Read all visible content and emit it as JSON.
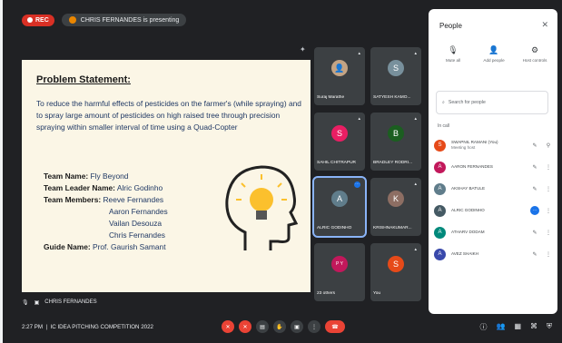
{
  "topbar": {
    "rec_label": "REC",
    "presenting_text": "CHRIS FERNANDES is presenting"
  },
  "slide": {
    "title": "Problem Statement:",
    "body": "To reduce the harmful effects of pesticides on the farmer's (while spraying) and to spray large amount of pesticides on high raised tree through precision spraying within  smaller interval of time using a Quad-Copter",
    "team_name_label": "Team Name:",
    "team_name": "Fly Beyond",
    "leader_label": "Team Leader Name:",
    "leader": "Alric Godinho",
    "members_label": "Team Members:",
    "members": [
      "Reeve Fernandes",
      "Aaron Fernandes",
      "Vailan Desouza",
      "Chris Fernandes"
    ],
    "guide_label": "Guide Name:",
    "guide": "Prof. Gaurish Samant"
  },
  "presenter_name": "CHRIS FERNANDES",
  "tiles": [
    {
      "name": "Suraj Marathe",
      "initial": "",
      "color": "#c4a484"
    },
    {
      "name": "SATYESH KAMO...",
      "initial": "S",
      "color": "#78909c"
    },
    {
      "name": "SAHIL CHITRAPUR",
      "initial": "S",
      "color": "#e91e63"
    },
    {
      "name": "BRADLEY RODRI...",
      "initial": "B",
      "color": "#1b5e20"
    },
    {
      "name": "ALRIC GODINHO",
      "initial": "A",
      "color": "#607d8b"
    },
    {
      "name": "KRISHNAKUMAR...",
      "initial": "K",
      "color": "#8d6e63"
    },
    {
      "name": "23 others",
      "initial": "P Y",
      "color": "#c2185b"
    },
    {
      "name": "You",
      "initial": "S",
      "color": "#e64a19"
    }
  ],
  "bottombar": {
    "time": "2:27 PM",
    "meeting": "IC IDEA PITCHING COMPETITION 2022"
  },
  "people_panel": {
    "title": "People",
    "mute_all": "Mute all",
    "add_people": "Add people",
    "host_controls": "Host controls",
    "search_placeholder": "Search for people",
    "in_call": "In call",
    "participants": [
      {
        "name": "SWAPNIL RAMANI (You)",
        "sub": "Meeting host",
        "initial": "S",
        "color": "#e64a19"
      },
      {
        "name": "AARON FERNANDES",
        "sub": "",
        "initial": "A",
        "color": "#c2185b"
      },
      {
        "name": "AKSHAY BATULE",
        "sub": "",
        "initial": "A",
        "color": "#607d8b"
      },
      {
        "name": "ALRIC GODINHO",
        "sub": "",
        "initial": "A",
        "color": "#455a64"
      },
      {
        "name": "ATHARV DODAM",
        "sub": "",
        "initial": "A",
        "color": "#00897b"
      },
      {
        "name": "AVEZ SHAIKH",
        "sub": "",
        "initial": "A",
        "color": "#3949ab"
      }
    ]
  },
  "icons": [
    "rec-dot-icon",
    "presentation-icon",
    "pin-icon",
    "close-icon",
    "mute-all-icon",
    "add-person-icon",
    "host-controls-icon",
    "search-icon",
    "mic-off-icon",
    "more-vert-icon",
    "lightbulb-head-icon",
    "mic-icon",
    "camera-icon",
    "captions-icon",
    "raise-hand-icon",
    "present-icon",
    "more-options-icon",
    "hang-up-icon",
    "info-icon",
    "people-icon",
    "chat-icon",
    "activities-icon",
    "lock-icon"
  ]
}
